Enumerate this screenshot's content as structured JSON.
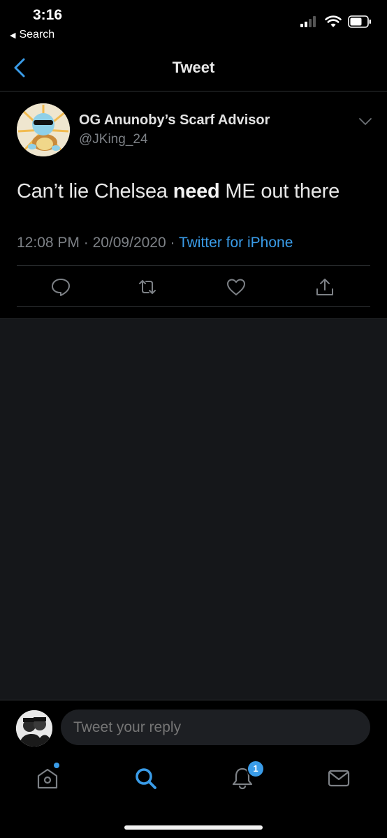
{
  "status_bar": {
    "time": "3:16",
    "back_label": "Search",
    "icons": [
      "cellular-signal-icon",
      "wifi-icon",
      "battery-icon"
    ]
  },
  "nav": {
    "title": "Tweet"
  },
  "tweet": {
    "author_name": "OG Anunoby’s Scarf Advisor",
    "author_handle": "@JKing_24",
    "text_before": "Can’t lie Chelsea ",
    "text_bold": "need",
    "text_after": " ME out there",
    "time": "12:08 PM",
    "date": "20/09/2020",
    "source": "Twitter for iPhone",
    "actions": [
      "reply-icon",
      "retweet-icon",
      "like-icon",
      "share-icon"
    ]
  },
  "reply": {
    "placeholder": "Tweet your reply"
  },
  "tab_bar": {
    "tabs": [
      "home",
      "search",
      "notifications",
      "messages"
    ],
    "active": "search",
    "notifications_count": "1"
  },
  "colors": {
    "accent": "#3a9ce8",
    "background": "#000000",
    "thread_background": "#15171a",
    "secondary_text": "#7d8186"
  }
}
